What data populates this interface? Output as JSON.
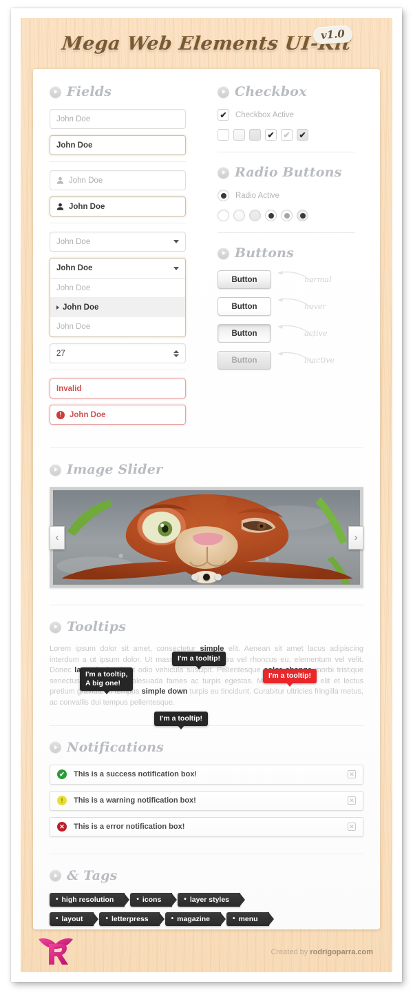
{
  "header": {
    "title": "Mega Web Elements UI-Kit",
    "version_badge": "v1.0"
  },
  "sections": {
    "fields": "Fields",
    "checkbox": "Checkbox",
    "radio": "Radio Buttons",
    "buttons": "Buttons",
    "image_slider": "Image Slider",
    "tooltips": "Tooltips",
    "notifications": "Notifications",
    "tags": "& Tags"
  },
  "fields": {
    "input_placeholder": "John Doe",
    "input_filled": "John Doe",
    "input_icon_placeholder": "John Doe",
    "input_icon_filled": "John Doe",
    "select_placeholder": "John Doe",
    "select_open_value": "John Doe",
    "select_options": [
      "John Doe",
      "John Doe",
      "John Doe"
    ],
    "select_selected_index": 1,
    "stepper_value": "27",
    "invalid_text": "Invalid",
    "error_text": "John Doe"
  },
  "checkbox": {
    "active_label": "Checkbox Active",
    "states": [
      {
        "name": "unchecked-normal",
        "checked": false,
        "shade": 1
      },
      {
        "name": "unchecked-hover",
        "checked": false,
        "shade": 2
      },
      {
        "name": "unchecked-active",
        "checked": false,
        "shade": 3
      },
      {
        "name": "checked-normal",
        "checked": true,
        "shade": 1,
        "tick": "dark"
      },
      {
        "name": "checked-hover",
        "checked": true,
        "shade": 1,
        "tick": "light"
      },
      {
        "name": "checked-active",
        "checked": true,
        "shade": 3,
        "tick": "dark"
      }
    ]
  },
  "radio": {
    "active_label": "Radio Active",
    "states": [
      {
        "name": "unselected-normal",
        "selected": false,
        "shade": 1
      },
      {
        "name": "unselected-hover",
        "selected": false,
        "shade": 2
      },
      {
        "name": "unselected-active",
        "selected": false,
        "shade": 3
      },
      {
        "name": "selected-normal",
        "selected": true,
        "shade": 1,
        "dot": "dark"
      },
      {
        "name": "selected-hover",
        "selected": true,
        "shade": 1,
        "dot": "mid"
      },
      {
        "name": "selected-active",
        "selected": true,
        "shade": 3,
        "dot": "dark"
      }
    ]
  },
  "buttons": {
    "label": "Button",
    "states": [
      {
        "label": "Button",
        "note": "normal"
      },
      {
        "label": "Button",
        "note": "hover"
      },
      {
        "label": "Button",
        "note": "active"
      },
      {
        "label": "Button",
        "note": "inactive"
      }
    ]
  },
  "slider": {
    "prev_icon": "‹",
    "next_icon": "›",
    "dots": 3,
    "active_dot": 1,
    "image_alt": "cartoon squirrel face close-up"
  },
  "tooltips": {
    "tip1": "I'm a tooltip,\nA big one!",
    "tip2": "I'm a tooltip!",
    "tip3": "I'm a tooltip!",
    "tip4": "I'm a tooltip!",
    "red_tip_color": "#e8272a",
    "paragraph_parts": {
      "p1": "Lorem ipsum dolor sit amet, consectetur ",
      "b1": "simple",
      "p2": " elit. Aenean sit amet lacus adipiscing interdum a ut ipsum dolor. Ut massa quam, pharetra vel rhoncus eu, elementum vel velit. Donec ",
      "b2": "large text",
      "p3": " velit ut odio vehicula suscipit. Pellentesque ",
      "b3": "color change",
      "p4": " morbi tristique senectus et netus et malesuada fames ac turpis egestas. Maecenas iaculis elit et lectus pretium gravida. In tempus ",
      "b4": "simple down",
      "p5": " turpis eu tincidunt. Curabitur ultricies fringilla metus, ac convallis dui tempus pellentesque."
    }
  },
  "notifications": [
    {
      "type": "success",
      "message": "This is a success notification box!",
      "icon": "check-circle-icon",
      "glyph": "✔",
      "color": "#2c9b3a",
      "close": "✕"
    },
    {
      "type": "warning",
      "message": "This is a warning notification box!",
      "icon": "warning-circle-icon",
      "glyph": "!",
      "color": "#e8e030",
      "close": "✕"
    },
    {
      "type": "error",
      "message": "This is a error notification box!",
      "icon": "error-circle-icon",
      "glyph": "✕",
      "color": "#bc1f2b",
      "close": "✕"
    }
  ],
  "tags": {
    "row1": [
      "high resolution",
      "icons",
      "layer styles"
    ],
    "row2": [
      "layout",
      "letterpress",
      "magazine",
      "menu"
    ]
  },
  "footer": {
    "credit_prefix": "Created by ",
    "credit_site": "rodrigoparra.com",
    "logo_letter": "R",
    "logo_color": "#e0218a"
  }
}
